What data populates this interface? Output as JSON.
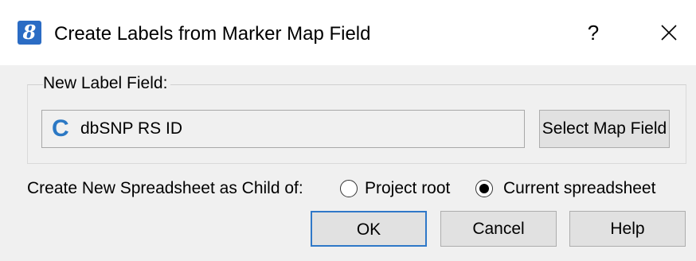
{
  "window": {
    "title": "Create Labels from Marker Map Field",
    "app_icon": "golden-helix-icon",
    "help_glyph": "?",
    "close_icon": "close-icon"
  },
  "group": {
    "label": "New Label Field:",
    "field_icon_glyph": "C",
    "field_value": "dbSNP RS ID",
    "select_button": "Select Map Field"
  },
  "parent": {
    "label": "Create New Spreadsheet as Child of:",
    "options": [
      {
        "label": "Project root",
        "selected": false
      },
      {
        "label": "Current spreadsheet",
        "selected": true
      }
    ]
  },
  "buttons": {
    "ok": "OK",
    "cancel": "Cancel",
    "help": "Help"
  },
  "colors": {
    "accent": "#2f78c8",
    "icon_blue": "#2b6cc4"
  }
}
